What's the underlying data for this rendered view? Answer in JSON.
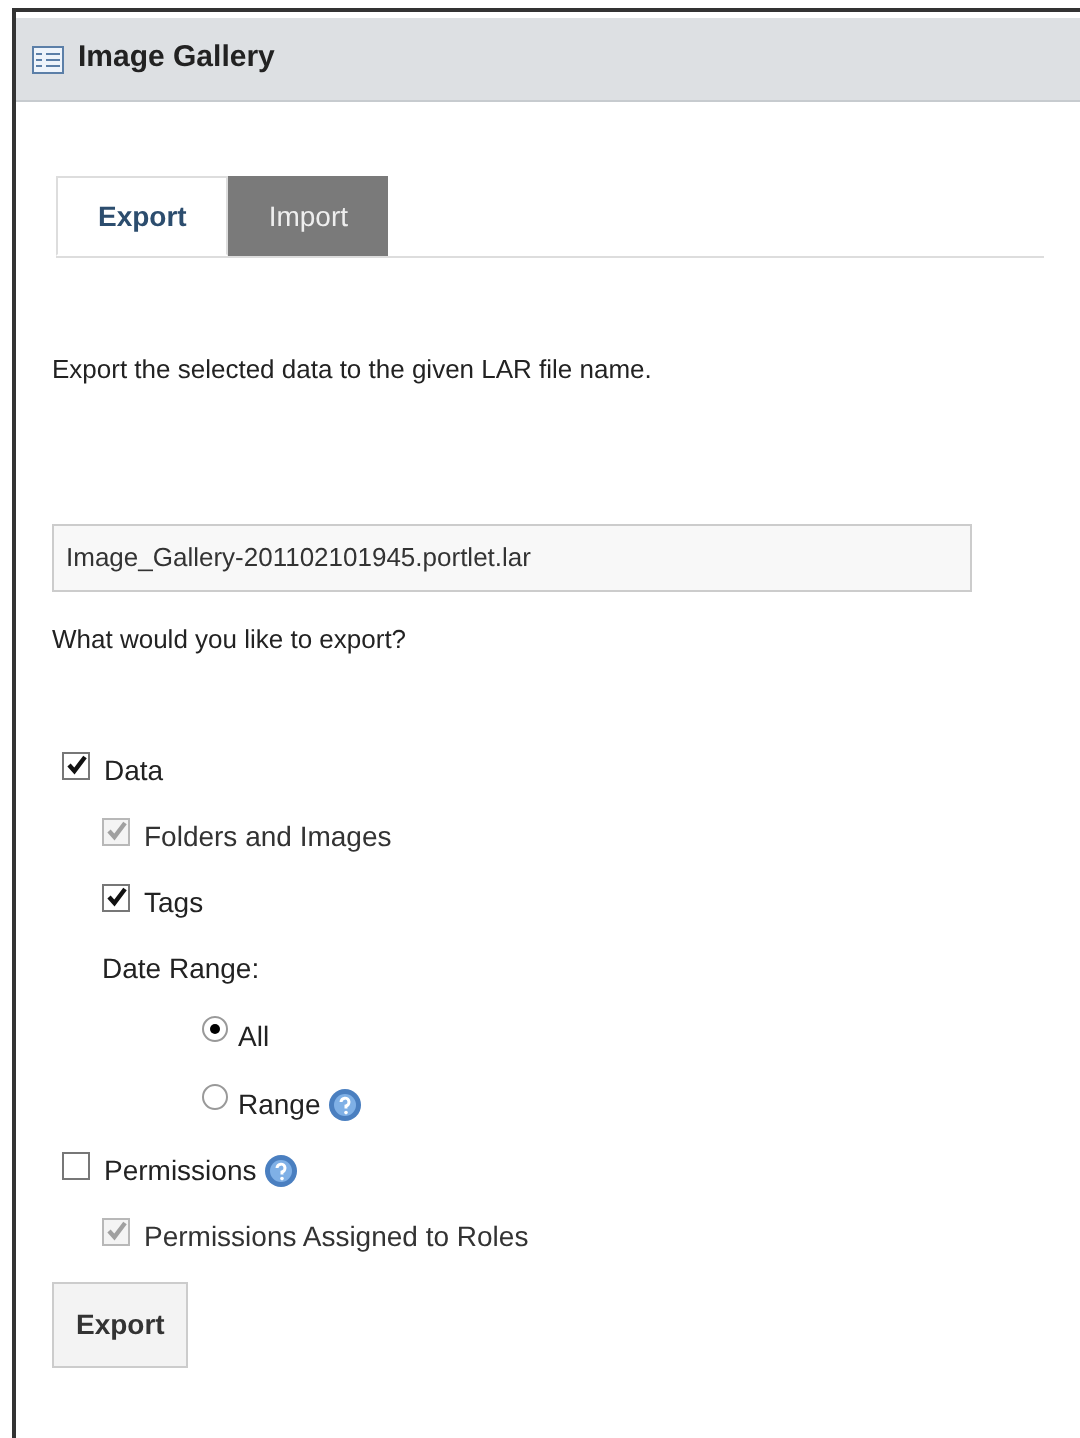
{
  "portlet": {
    "title": "Image Gallery"
  },
  "tabs": [
    {
      "label": "Export",
      "selected": true
    },
    {
      "label": "Import",
      "selected": false
    }
  ],
  "intro": "Export the selected data to the given LAR file name.",
  "file_name": {
    "value": "Image_Gallery-201102101945.portlet.lar"
  },
  "question": "What would you like to export?",
  "options": [
    {
      "kind": "checkbox",
      "label": "Data",
      "checked": true,
      "disabled": false,
      "help": false,
      "children": [
        {
          "kind": "checkbox",
          "label": "Folders and Images",
          "checked": true,
          "disabled": true,
          "help": false
        },
        {
          "kind": "checkbox",
          "label": "Tags",
          "checked": true,
          "disabled": false,
          "help": false
        },
        {
          "kind": "label",
          "label": "Date Range:",
          "children": [
            {
              "kind": "radio",
              "label": "All",
              "selected": true,
              "help": false
            },
            {
              "kind": "radio",
              "label": "Range",
              "selected": false,
              "help": true
            }
          ]
        }
      ]
    },
    {
      "kind": "checkbox",
      "label": "Permissions",
      "checked": false,
      "disabled": false,
      "help": true,
      "children": [
        {
          "kind": "checkbox",
          "label": "Permissions Assigned to Roles",
          "checked": true,
          "disabled": true,
          "help": false
        }
      ]
    }
  ],
  "submit": "Export"
}
